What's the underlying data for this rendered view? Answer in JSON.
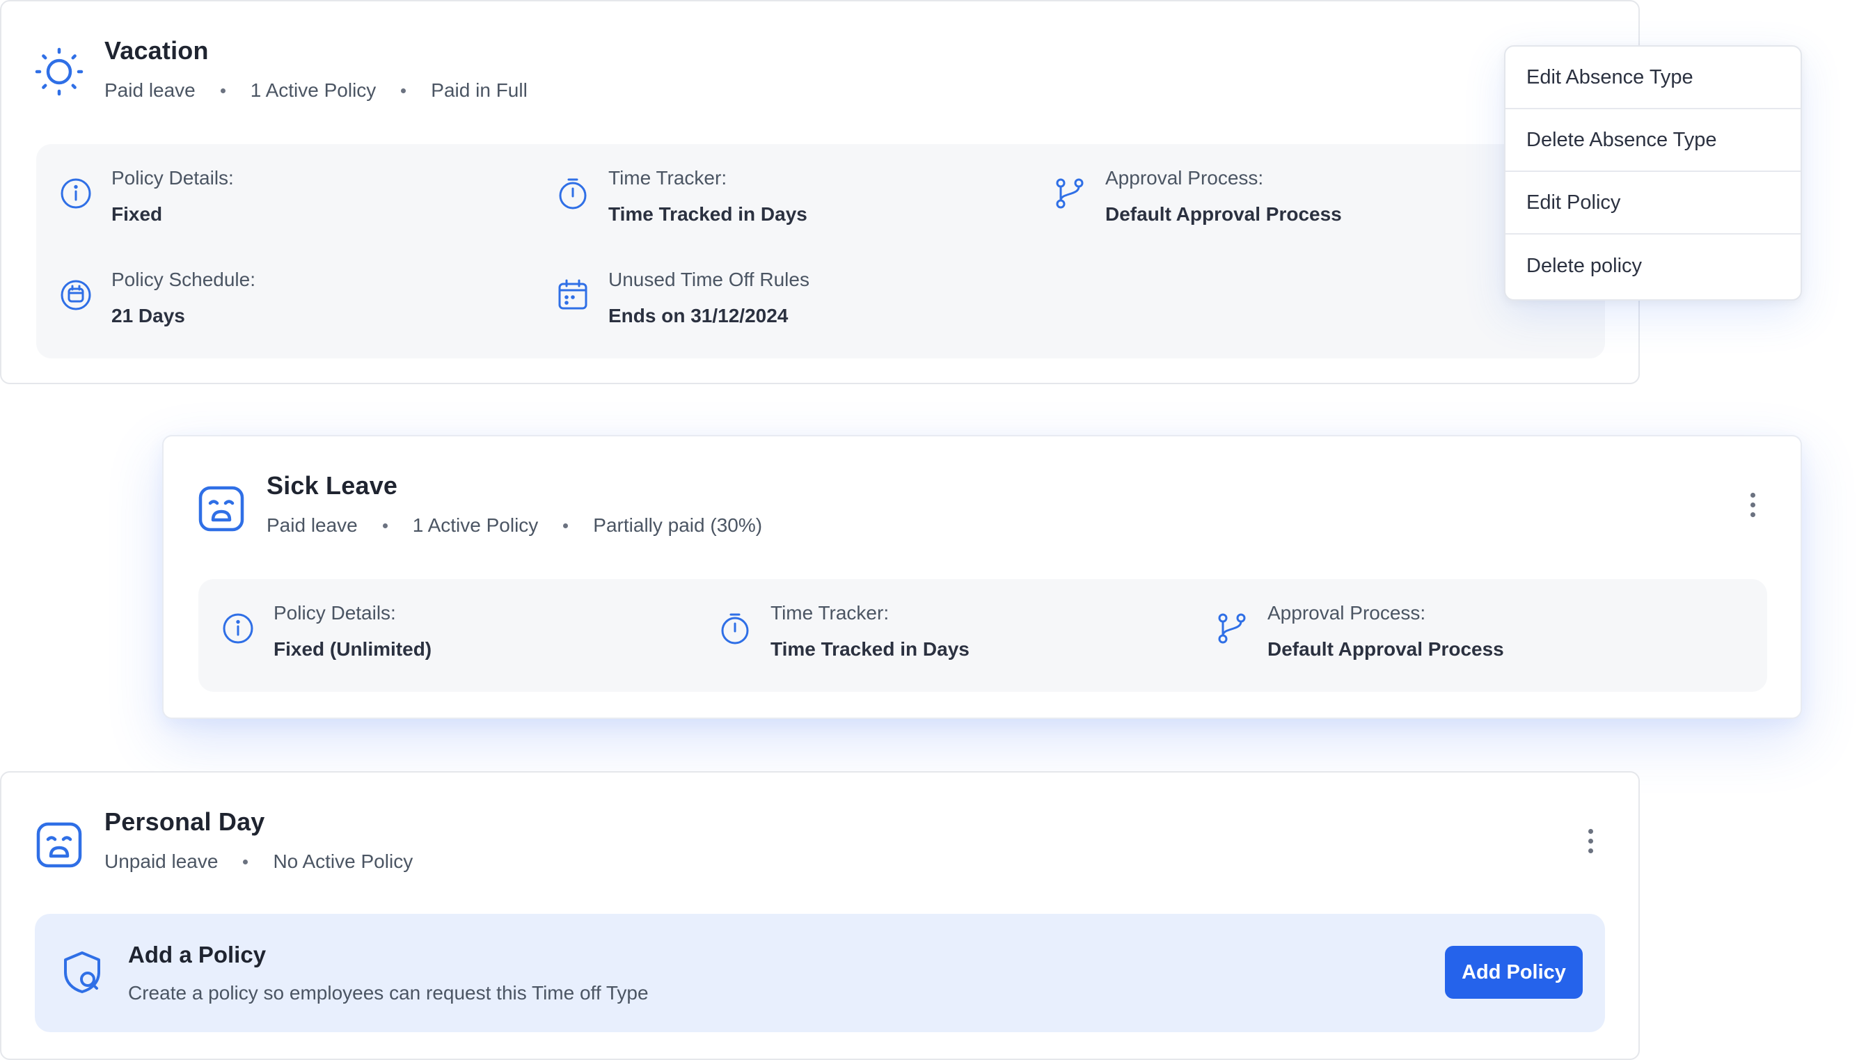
{
  "colors": {
    "accent": "#2563eb",
    "icon": "#2f6fe6",
    "panel": "#f6f7f9",
    "add_panel": "#e8effd"
  },
  "vacation": {
    "icon": "sun-icon",
    "title": "Vacation",
    "meta": [
      "Paid leave",
      "1 Active Policy",
      "Paid in Full"
    ],
    "details": [
      {
        "icon": "info-icon",
        "label": "Policy Details:",
        "value": "Fixed"
      },
      {
        "icon": "stopwatch-icon",
        "label": "Time Tracker:",
        "value": "Time Tracked in Days"
      },
      {
        "icon": "branch-icon",
        "label": "Approval Process:",
        "value": "Default Approval Process"
      },
      {
        "icon": "calendar-clock-icon",
        "label": "Policy Schedule:",
        "value": "21 Days"
      },
      {
        "icon": "calendar-icon",
        "label": "Unused Time Off Rules",
        "value": "Ends on 31/12/2024"
      }
    ]
  },
  "context_menu": {
    "items": [
      "Edit Absence Type",
      "Delete Absence Type",
      "Edit Policy",
      "Delete policy"
    ]
  },
  "sick_leave": {
    "icon": "sad-face-icon",
    "title": "Sick Leave",
    "meta": [
      "Paid leave",
      "1 Active Policy",
      "Partially paid (30%)"
    ],
    "details": [
      {
        "icon": "info-icon",
        "label": "Policy Details:",
        "value": "Fixed (Unlimited)"
      },
      {
        "icon": "stopwatch-icon",
        "label": "Time Tracker:",
        "value": "Time Tracked in Days"
      },
      {
        "icon": "branch-icon",
        "label": "Approval Process:",
        "value": "Default Approval Process"
      }
    ]
  },
  "personal_day": {
    "icon": "sad-face-icon",
    "title": "Personal Day",
    "meta": [
      "Unpaid leave",
      "No Active Policy"
    ],
    "add_policy": {
      "icon": "shield-search-icon",
      "title": "Add a Policy",
      "description": "Create a policy so employees can request this Time off Type",
      "button": "Add Policy"
    }
  }
}
